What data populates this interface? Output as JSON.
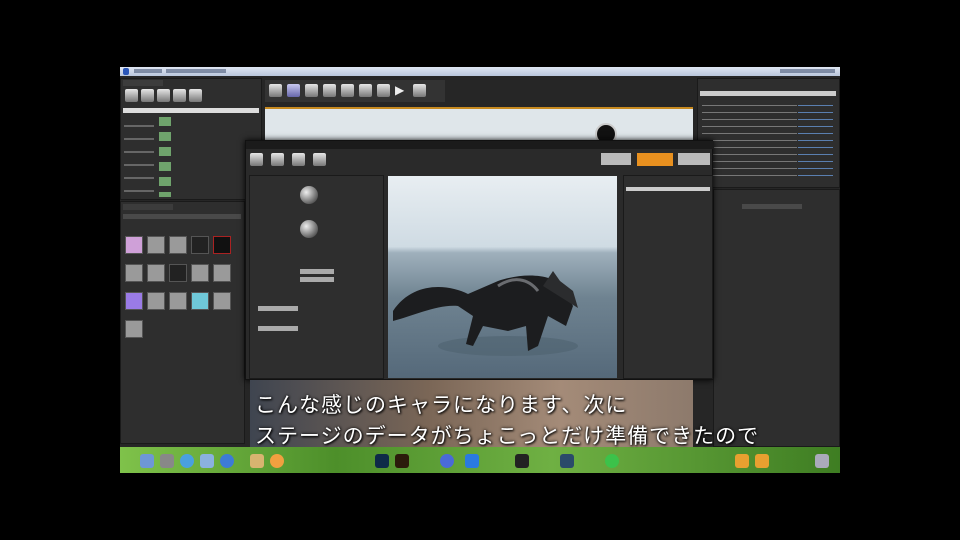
{
  "subtitle": {
    "line1": "こんな感じのキャラになります、次に",
    "line2": "ステージのデータがちょこっとだけ準備できたので"
  },
  "colors": {
    "accent": "#e8901f",
    "dock": "#6fb043"
  },
  "dock_icons": [
    "finder",
    "launchpad",
    "safari",
    "mail",
    "chrome",
    "app-store",
    "notes",
    "calendar",
    "photoshop",
    "illustrator",
    "unreal",
    "twitter",
    "line",
    "steam",
    "terminal",
    "trash"
  ]
}
